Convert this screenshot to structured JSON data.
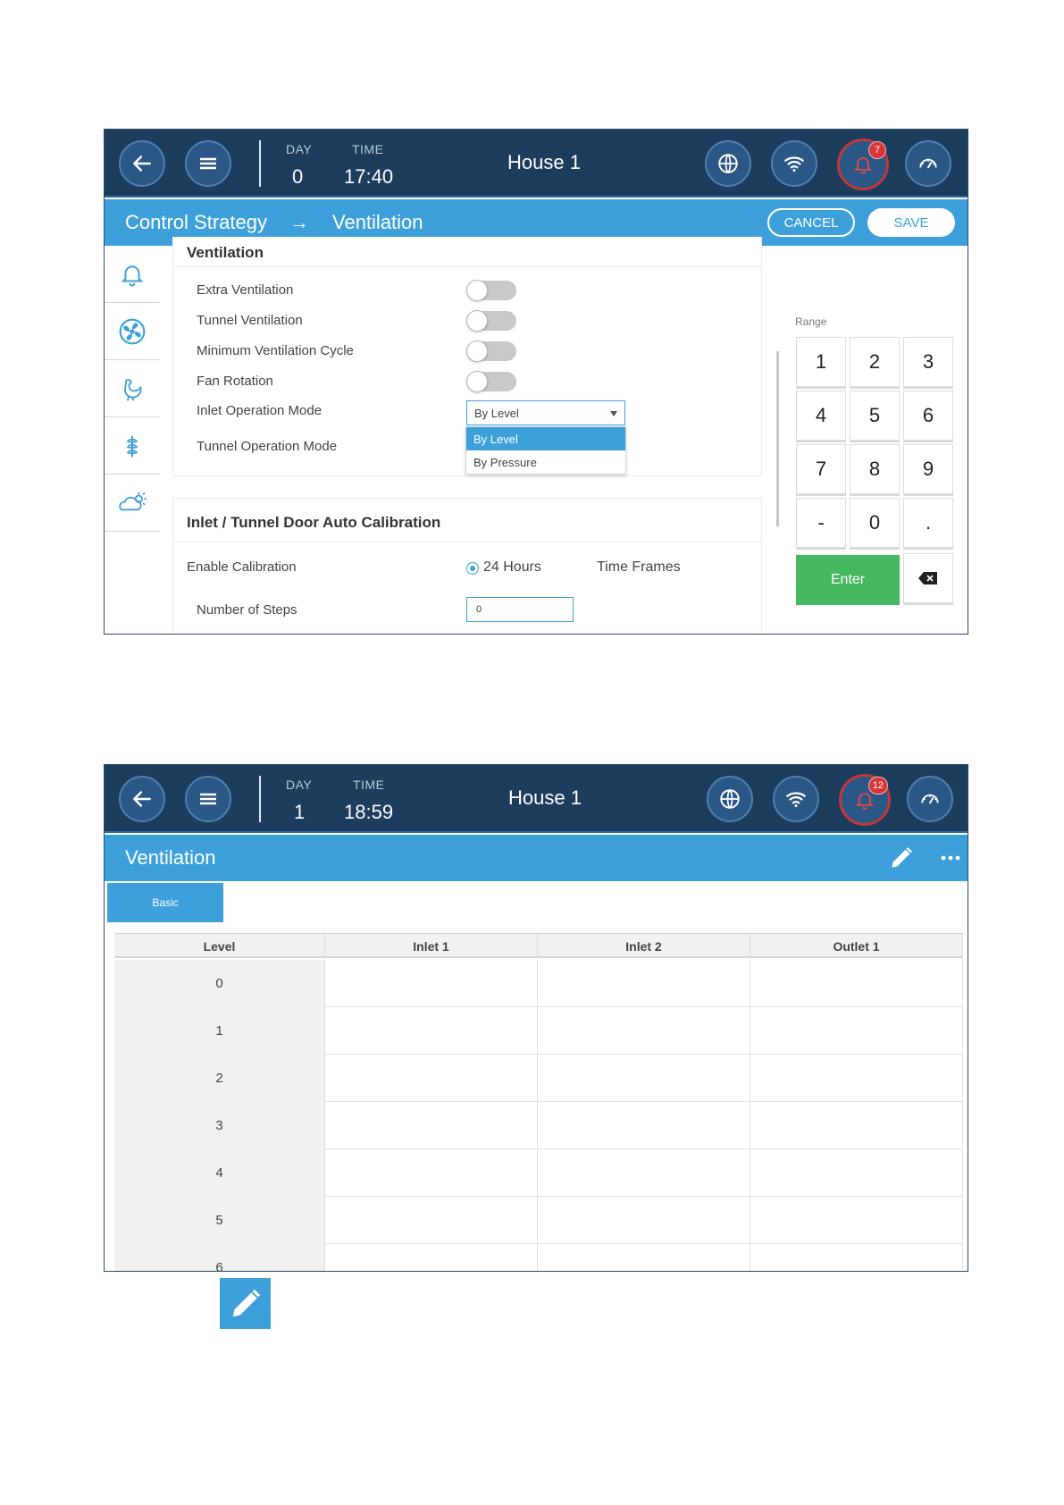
{
  "screen1": {
    "header": {
      "day_label": "DAY",
      "day_value": "0",
      "time_label": "TIME",
      "time_value": "17:40",
      "house": "House 1",
      "alarm_count": "7"
    },
    "subheader": {
      "breadcrumb_parent": "Control Strategy",
      "arrow": "→",
      "breadcrumb_current": "Ventilation",
      "cancel_label": "CANCEL",
      "save_label": "SAVE"
    },
    "sidenav": [
      "bell-icon",
      "fan-icon",
      "bird-icon",
      "plant-icon",
      "weather-icon"
    ],
    "ventilation": {
      "title": "Ventilation",
      "extra_ventilation": "Extra Ventilation",
      "tunnel_ventilation": "Tunnel Ventilation",
      "minimum_ventilation_cycle": "Minimum Ventilation Cycle",
      "fan_rotation": "Fan Rotation",
      "inlet_operation_mode": "Inlet Operation Mode",
      "inlet_operation_value": "By Level",
      "tunnel_operation_mode": "Tunnel Operation Mode",
      "dropdown_options": [
        "By Level",
        "By Pressure"
      ],
      "dropdown_selected": "By Level"
    },
    "calibration": {
      "title": "Inlet / Tunnel Door Auto Calibration",
      "enable_calibration": "Enable Calibration",
      "option_24h": "24 Hours",
      "option_time_frames": "Time Frames",
      "selected_option": "24 Hours",
      "number_of_steps": "Number of Steps",
      "number_of_steps_value": "0"
    },
    "keypad": {
      "range_label": "Range",
      "keys": [
        "1",
        "2",
        "3",
        "4",
        "5",
        "6",
        "7",
        "8",
        "9",
        "-",
        "0",
        "."
      ],
      "enter_label": "Enter"
    }
  },
  "screen2": {
    "header": {
      "day_label": "DAY",
      "day_value": "1",
      "time_label": "TIME",
      "time_value": "18:59",
      "house": "House 1",
      "alarm_count": "12"
    },
    "subheader": {
      "title": "Ventilation"
    },
    "tab_basic": "Basic",
    "table": {
      "headers": [
        "Level",
        "Inlet 1",
        "Inlet 2",
        "Outlet 1"
      ],
      "levels": [
        "0",
        "1",
        "2",
        "3",
        "4",
        "5",
        "6"
      ]
    }
  },
  "colors": {
    "header_bg": "#1c3d5e",
    "accent": "#3ea0da",
    "enter_green": "#47b862",
    "alarm_red": "#d9343a"
  }
}
